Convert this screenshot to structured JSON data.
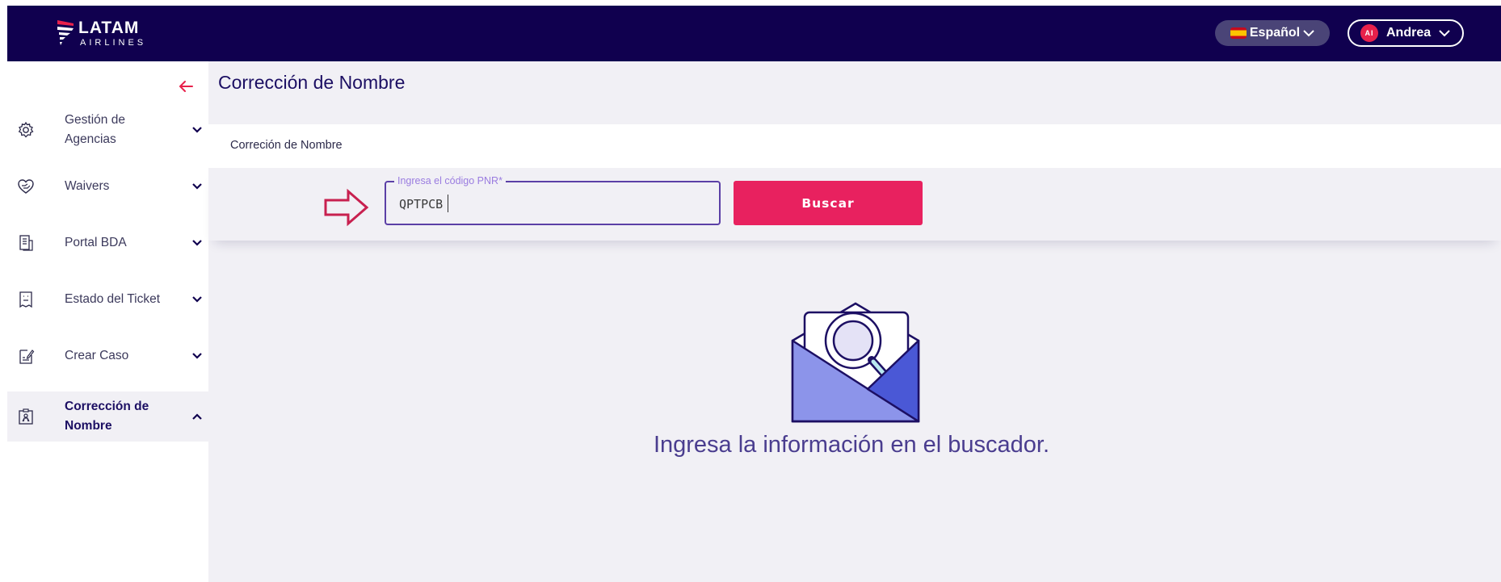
{
  "header": {
    "logo_brand": "LATAM",
    "logo_sub": "AIRLINES",
    "language": "Español",
    "user_initials": "AI",
    "user_name": "Andrea"
  },
  "sidebar": {
    "items": [
      {
        "label": "Gestión de Agencias",
        "icon": "gear-icon",
        "expanded": false
      },
      {
        "label": "Waivers",
        "icon": "heart-hand-icon",
        "expanded": false
      },
      {
        "label": "Portal BDA",
        "icon": "document-list-icon",
        "expanded": false
      },
      {
        "label": "Estado del Ticket",
        "icon": "receipt-icon",
        "expanded": false
      },
      {
        "label": "Crear Caso",
        "icon": "clipboard-edit-icon",
        "expanded": false
      },
      {
        "label": "Corrección de Nombre",
        "icon": "badge-person-icon",
        "expanded": true,
        "active": true
      }
    ]
  },
  "main": {
    "title": "Corrección de Nombre",
    "breadcrumb": "Correción de Nombre",
    "search": {
      "label": "Ingresa el código PNR*",
      "value": "QPTPCB",
      "button": "Buscar"
    },
    "empty_message": "Ingresa la información en el buscador."
  },
  "colors": {
    "topbar": "#10004f",
    "accent": "#e8215f",
    "primary_text": "#1c0f63"
  }
}
